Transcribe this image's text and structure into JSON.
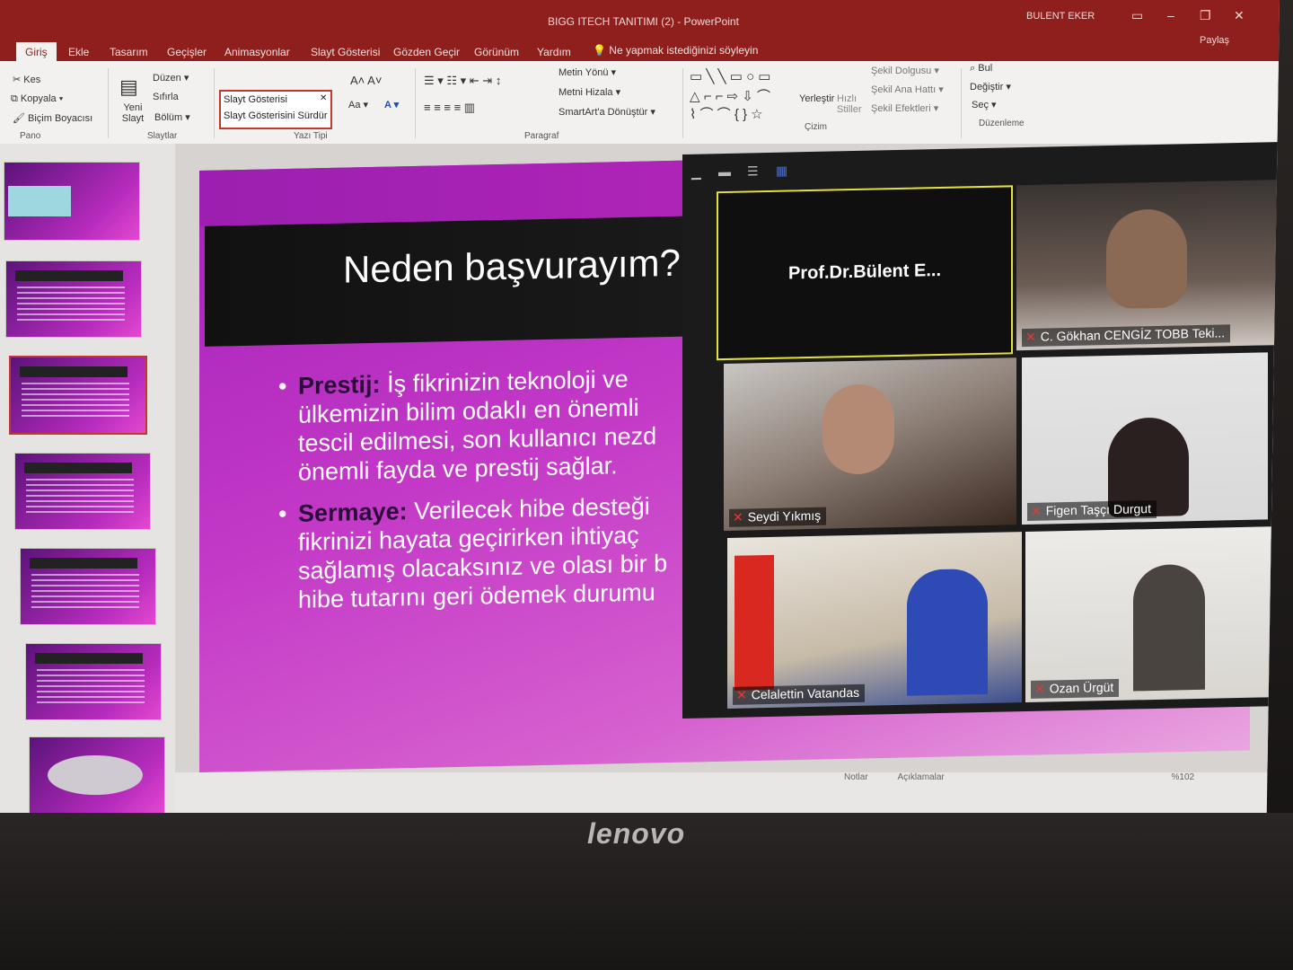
{
  "window": {
    "title": "BIGG ITECH TANITIMI (2)  -  PowerPoint",
    "user": "BULENT EKER",
    "share": "Paylaş"
  },
  "tabs": [
    "Giriş",
    "Ekle",
    "Tasarım",
    "Geçişler",
    "Animasyonlar",
    "Slayt Gösterisi",
    "Gözden Geçir",
    "Görünüm",
    "Yardım"
  ],
  "tell_me": "Ne yapmak istediğinizi söyleyin",
  "ribbon": {
    "pano": {
      "label": "Pano",
      "cut": "Kes",
      "copy": "Kopyala",
      "painter": "Biçim Boyacısı"
    },
    "slaytlar": {
      "label": "Slaytlar",
      "new": "Yeni Slayt",
      "layout": "Düzen",
      "reset": "Sıfırla",
      "section": "Bölüm"
    },
    "font": {
      "label": "Yazı Tipi",
      "tip1": "Slayt Gösterisi",
      "tip2": "Slayt Gösterisini Sürdür"
    },
    "paragraph": {
      "label": "Paragraf",
      "text_dir": "Metin Yönü",
      "align": "Metni Hizala",
      "smartart": "SmartArt'a Dönüştür"
    },
    "drawing": {
      "label": "Çizim",
      "arrange": "Yerleştir",
      "quick": "Hızlı Stiller",
      "fill": "Şekil Dolgusu",
      "outline": "Şekil Ana Hattı",
      "effects": "Şekil Efektleri"
    },
    "editing": {
      "label": "Düzenleme",
      "find": "Bul",
      "replace": "Değiştir",
      "select": "Seç"
    }
  },
  "slide": {
    "title": "Neden başvurayım?",
    "bullets": [
      {
        "key": "Prestij:",
        "text": "İş fikrinizin teknoloji ve ülkemizin bilim odaklı en önemli tescil edilmesi, son kullanıcı nezd önemli fayda ve prestij sağlar."
      },
      {
        "key": "Sermaye:",
        "text": "Verilecek hibe desteği fikrinizi hayata geçirirken ihtiyaç sağlamış olacaksınız ve olası bir b hibe tutarını geri ödemek durumu"
      }
    ]
  },
  "zoom": {
    "participants": [
      {
        "name": "Prof.Dr.Bülent E...",
        "kind": "speaker"
      },
      {
        "name": "C. Gökhan CENGİZ TOBB Teki...",
        "kind": "video"
      },
      {
        "name": "Seydi Yıkmış",
        "kind": "video"
      },
      {
        "name": "Figen Taşçı Durgut",
        "kind": "video"
      },
      {
        "name": "Celalettin Vatandas",
        "kind": "video"
      },
      {
        "name": "Ozan Ürgüt",
        "kind": "video"
      }
    ]
  },
  "statusbar": {
    "notes": "Notlar",
    "comments": "Açıklamalar",
    "zoom": "%102"
  },
  "brand": "lenovo"
}
